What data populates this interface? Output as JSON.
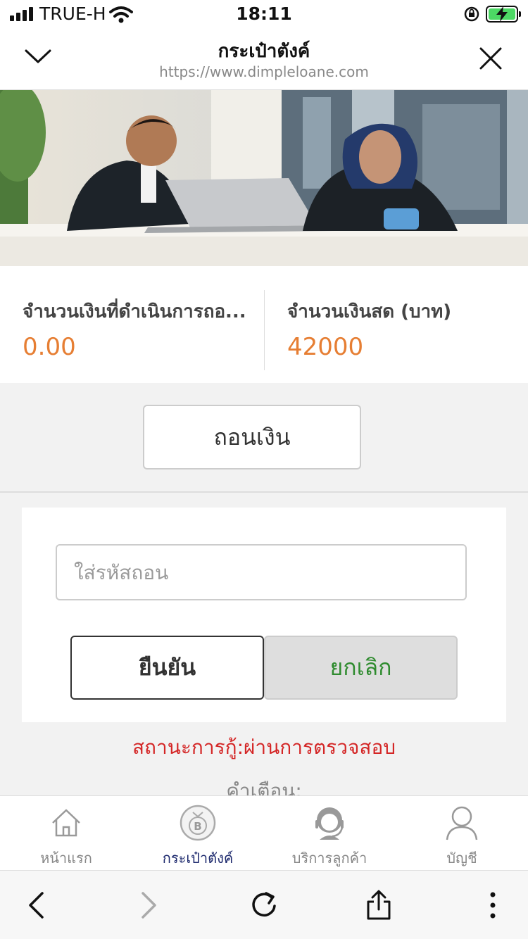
{
  "status_bar": {
    "carrier": "TRUE-H",
    "time": "18:11"
  },
  "header": {
    "title": "กระเป๋าตังค์",
    "url": "https://www.dimpleloane.com"
  },
  "amounts": {
    "processing_label": "จำนวนเงินที่ดำเนินการถอ...",
    "processing_value": "0.00",
    "cash_label": "จำนวนเงินสด (บาท)",
    "cash_value": "42000"
  },
  "withdraw_button": "ถอนเงิน",
  "form": {
    "code_placeholder": "ใส่รหัสถอน",
    "confirm_label": "ยืนยัน",
    "cancel_label": "ยกเลิก"
  },
  "loan_status": "สถานะการกู้:ผ่านการตรวจสอบ",
  "warning_label": "คำเตือน:",
  "tabbar": [
    {
      "label": "หน้าแรก",
      "icon": "home-icon"
    },
    {
      "label": "กระเป๋าตังค์",
      "icon": "wallet-icon"
    },
    {
      "label": "บริการลูกค้า",
      "icon": "customer-service-icon"
    },
    {
      "label": "บัญชี",
      "icon": "account-icon"
    }
  ],
  "colors": {
    "amount": "#e67e33",
    "status": "#d42626",
    "cancel": "#2e8b2e",
    "active_tab": "#1e2a6e"
  }
}
